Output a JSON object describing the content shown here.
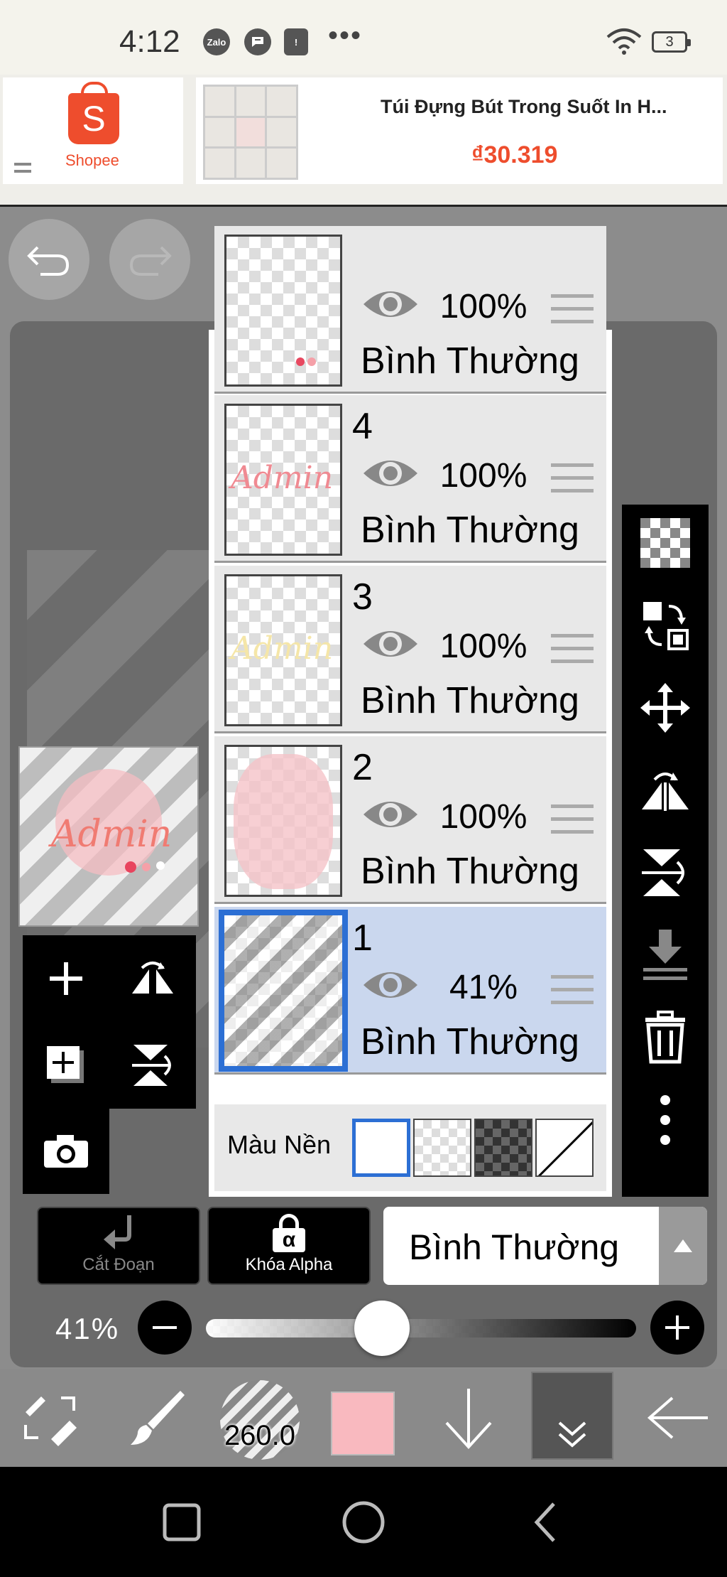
{
  "status_bar": {
    "time": "4:12",
    "zalo_icon": "Zalo",
    "battery": "3"
  },
  "ad": {
    "brand": "Shopee",
    "logo_letter": "S",
    "product_title": "Túi Đựng Bút Trong Suốt In H...",
    "price": "₫30.319"
  },
  "layers": [
    {
      "number": "",
      "opacity": "100%",
      "mode": "Bình Thường",
      "selected": false
    },
    {
      "number": "4",
      "opacity": "100%",
      "mode": "Bình Thường",
      "selected": false,
      "thumb_text": "Admin"
    },
    {
      "number": "3",
      "opacity": "100%",
      "mode": "Bình Thường",
      "selected": false,
      "thumb_text": "Admin"
    },
    {
      "number": "2",
      "opacity": "100%",
      "mode": "Bình Thường",
      "selected": false
    },
    {
      "number": "1",
      "opacity": "41%",
      "mode": "Bình Thường",
      "selected": true
    }
  ],
  "background": {
    "label": "Màu Nền",
    "selected": "white"
  },
  "preview": {
    "art_text": "Admin"
  },
  "controls": {
    "clip_label": "Cắt Đoạn",
    "alpha_lock_label": "Khóa Alpha",
    "alpha_symbol": "α",
    "blend_mode": "Bình Thường",
    "opacity_label": "41%",
    "opacity_value": 0.41
  },
  "bottom_toolbar": {
    "brush_size": "260.0",
    "color": "#f9b9bf"
  },
  "colors": {
    "accent": "#2c6fd4",
    "selected_layer_bg": "#cad7ee",
    "shopee": "#ee4d2d"
  }
}
